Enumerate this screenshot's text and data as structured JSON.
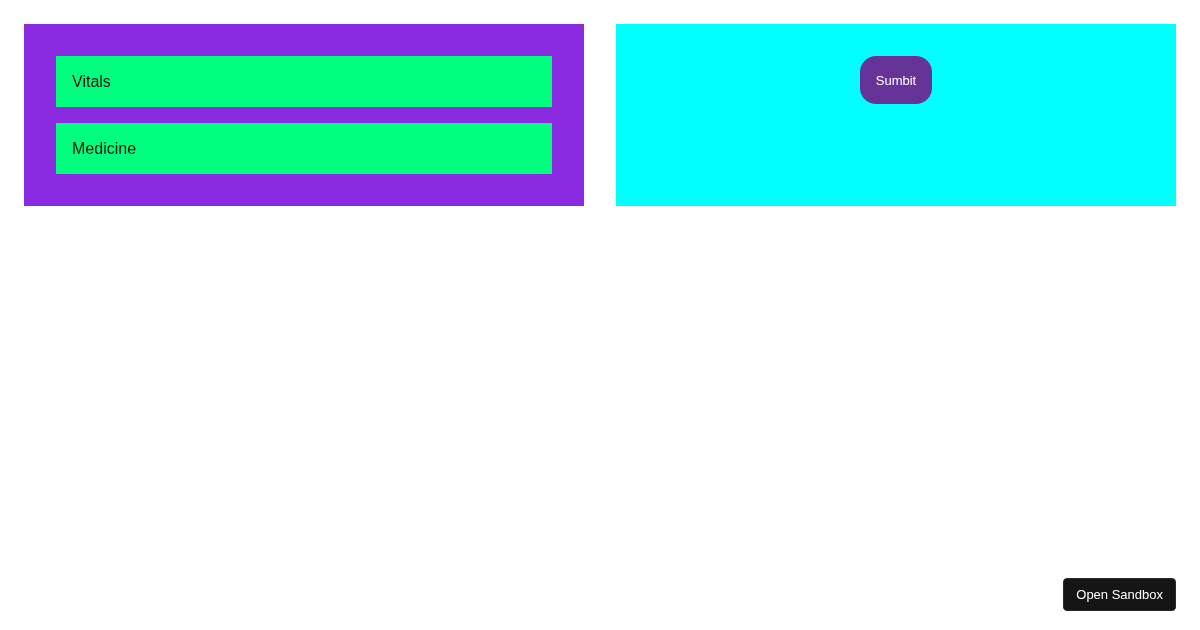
{
  "left_panel": {
    "items": [
      {
        "label": "Vitals"
      },
      {
        "label": "Medicine"
      }
    ]
  },
  "right_panel": {
    "button": {
      "label": "Sumbit"
    }
  },
  "sandbox_button": {
    "label": "Open Sandbox"
  }
}
